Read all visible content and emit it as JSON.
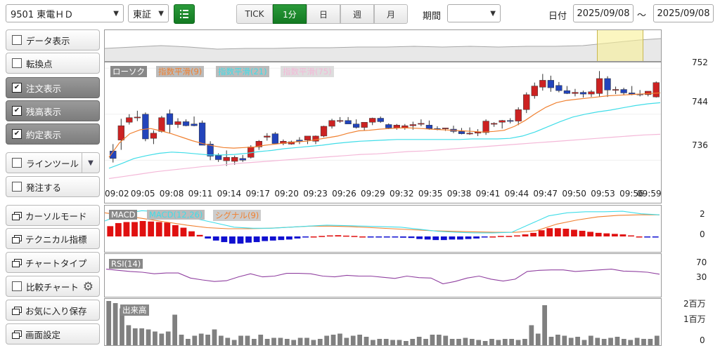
{
  "toolbar": {
    "symbol": "9501 東電ＨＤ",
    "exchange": "東証",
    "intervals": [
      "TICK",
      "1分",
      "日",
      "週",
      "月"
    ],
    "active_interval": "1分",
    "period_label": "期間",
    "period_value": "",
    "date_label": "日付",
    "date_from": "2025/09/08",
    "date_sep": "～",
    "date_to": "2025/09/08"
  },
  "sidebar": [
    {
      "label": "データ表示",
      "kind": "check",
      "checked": false
    },
    {
      "label": "転換点",
      "kind": "check",
      "checked": false
    },
    {
      "label": "注文表示",
      "kind": "check",
      "checked": true
    },
    {
      "label": "残高表示",
      "kind": "check",
      "checked": true
    },
    {
      "label": "約定表示",
      "kind": "check",
      "checked": true
    },
    {
      "label": "ラインツール",
      "kind": "check-dropdown",
      "checked": false
    },
    {
      "label": "発注する",
      "kind": "check",
      "checked": false
    },
    {
      "label": "カーソルモード",
      "kind": "window"
    },
    {
      "label": "テクニカル指標",
      "kind": "window"
    },
    {
      "label": "チャートタイプ",
      "kind": "window"
    },
    {
      "label": "比較チャート",
      "kind": "check-gear",
      "checked": false
    },
    {
      "label": "お気に入り保存",
      "kind": "window"
    },
    {
      "label": "画面設定",
      "kind": "window"
    }
  ],
  "colors": {
    "up": "#cc2222",
    "down": "#2244bb",
    "ema9": "#f08030",
    "ema21": "#40dde8",
    "ema75": "#f4b8d8",
    "rsi": "#9040a0",
    "volume": "#808080",
    "active_green": "#1a8a2a"
  },
  "chart_data": [
    {
      "type": "candlestick",
      "title": "",
      "legend": [
        "ローソク",
        "指数平滑(9)",
        "指数平滑(21)",
        "指数平滑(75)"
      ],
      "x_ticks": [
        "09:02",
        "09:05",
        "09:08",
        "09:11",
        "09:14",
        "09:17",
        "09:20",
        "09:23",
        "09:26",
        "09:29",
        "09:32",
        "09:35",
        "09:38",
        "09:41",
        "09:44",
        "09:47",
        "09:50",
        "09:53",
        "09:56",
        "09:59"
      ],
      "y_ticks": [
        752,
        744,
        736
      ],
      "ylim": [
        732.5,
        753
      ],
      "ohlc": [
        [
          737.6,
          738.8,
          735.6,
          736.3
        ],
        [
          739.5,
          743.2,
          737.8,
          742.0
        ],
        [
          742.6,
          744.0,
          742.2,
          743.4
        ],
        [
          743.4,
          744.6,
          742.8,
          743.5
        ],
        [
          744.0,
          744.3,
          739.3,
          739.7
        ],
        [
          739.8,
          741.2,
          738.8,
          740.7
        ],
        [
          741.0,
          743.7,
          740.8,
          743.4
        ],
        [
          744.1,
          744.8,
          740.7,
          742.2
        ],
        [
          742.2,
          743.3,
          741.6,
          742.7
        ],
        [
          742.7,
          743.1,
          741.9,
          742.0
        ],
        [
          742.3,
          743.6,
          741.9,
          742.0
        ],
        [
          742.5,
          742.9,
          738.6,
          738.6
        ],
        [
          738.8,
          739.3,
          736.0,
          736.7
        ],
        [
          736.8,
          737.2,
          735.7,
          736.1
        ],
        [
          735.9,
          737.7,
          735.0,
          736.5
        ],
        [
          735.8,
          736.8,
          735.2,
          736.5
        ],
        [
          736.3,
          736.9,
          735.7,
          736.0
        ],
        [
          736.5,
          738.6,
          736.3,
          738.3
        ],
        [
          738.3,
          739.5,
          737.8,
          739.3
        ],
        [
          740.0,
          740.7,
          739.4,
          740.2
        ],
        [
          740.6,
          740.9,
          738.9,
          738.9
        ],
        [
          738.9,
          739.6,
          738.6,
          739.3
        ],
        [
          738.8,
          739.4,
          738.7,
          739.2
        ],
        [
          739.5,
          740.0,
          738.8,
          739.3
        ],
        [
          739.5,
          740.0,
          738.8,
          740.2
        ],
        [
          739.3,
          740.3,
          738.8,
          740.2
        ],
        [
          740.2,
          742.0,
          740.0,
          741.9
        ],
        [
          741.9,
          743.2,
          741.5,
          742.9
        ],
        [
          742.9,
          743.5,
          742.5,
          742.9
        ],
        [
          742.9,
          743.5,
          742.5,
          742.3
        ],
        [
          742.3,
          743.1,
          741.5,
          741.7
        ],
        [
          741.7,
          742.6,
          741.1,
          742.6
        ],
        [
          742.6,
          743.4,
          742.1,
          743.3
        ],
        [
          743.3,
          743.6,
          742.5,
          742.7
        ],
        [
          742.2,
          742.4,
          741.4,
          741.6
        ],
        [
          741.6,
          742.3,
          741.3,
          742.1
        ],
        [
          741.6,
          742.3,
          741.3,
          742.0
        ],
        [
          742.0,
          742.7,
          741.3,
          742.2
        ],
        [
          742.3,
          743.1,
          741.9,
          742.4
        ],
        [
          742.1,
          742.9,
          741.3,
          741.5
        ],
        [
          741.5,
          741.9,
          741.2,
          741.4
        ],
        [
          741.5,
          741.6,
          741.1,
          741.6
        ],
        [
          741.4,
          742.0,
          740.7,
          741.0
        ],
        [
          741.0,
          741.6,
          740.5,
          740.6
        ],
        [
          740.6,
          741.7,
          740.4,
          740.7
        ],
        [
          740.7,
          741.4,
          740.2,
          740.9
        ],
        [
          740.8,
          743.1,
          740.4,
          742.8
        ],
        [
          742.3,
          742.6,
          741.8,
          742.4
        ],
        [
          742.6,
          743.0,
          741.5,
          742.9
        ],
        [
          742.9,
          743.3,
          742.4,
          742.8
        ],
        [
          742.8,
          745.2,
          742.1,
          744.8
        ],
        [
          744.8,
          747.8,
          744.2,
          747.4
        ],
        [
          747.2,
          749.5,
          746.7,
          748.9
        ],
        [
          748.7,
          751.0,
          748.1,
          749.9
        ],
        [
          749.9,
          750.7,
          747.9,
          748.6
        ],
        [
          749.0,
          749.6,
          747.8,
          748.1
        ],
        [
          748.1,
          748.9,
          747.5,
          747.6
        ],
        [
          747.6,
          748.4,
          747.1,
          747.8
        ],
        [
          747.8,
          748.1,
          746.9,
          747.5
        ],
        [
          747.5,
          748.2,
          747.0,
          747.9
        ],
        [
          747.6,
          751.5,
          747.0,
          750.2
        ],
        [
          750.2,
          750.6,
          747.0,
          748.2
        ],
        [
          748.2,
          748.8,
          747.5,
          748.3
        ],
        [
          748.3,
          748.6,
          747.3,
          747.7
        ],
        [
          747.7,
          748.9,
          747.3,
          747.5
        ],
        [
          747.5,
          748.2,
          747.1,
          747.4
        ],
        [
          747.4,
          748.0,
          747.1,
          748.0
        ],
        [
          747.0,
          749.7,
          746.9,
          749.5
        ]
      ],
      "ema9": [
        736.5,
        739.0,
        740.6,
        741.3,
        741.5,
        741.1,
        740.6,
        740.0,
        739.4,
        738.9,
        738.5,
        738.2,
        738.1,
        738.2,
        738.3,
        738.6,
        738.8,
        739.0,
        739.2,
        739.3,
        739.6,
        739.9,
        740.2,
        740.7,
        741.1,
        741.2,
        741.4,
        741.5,
        741.6,
        741.6,
        741.5,
        741.4,
        741.3,
        741.2,
        741.1,
        741.0,
        740.9,
        741.0,
        741.2,
        741.9,
        742.9,
        744.1,
        745.2,
        746.0,
        746.4,
        746.6,
        746.8,
        747.0,
        747.2,
        747.3,
        747.4,
        747.5,
        747.6,
        747.7
      ],
      "ema21": [
        734.6,
        735.4,
        736.3,
        736.8,
        737.2,
        737.4,
        737.3,
        737.1,
        736.9,
        736.9,
        737.0,
        737.2,
        737.5,
        737.7,
        738.0,
        738.2,
        738.4,
        738.6,
        738.9,
        739.1,
        739.3,
        739.4,
        739.5,
        739.6,
        739.6,
        739.6,
        739.6,
        739.6,
        739.6,
        739.7,
        739.7,
        739.7,
        739.8,
        740.2,
        740.9,
        741.8,
        742.7,
        743.5,
        744.0,
        744.4,
        744.7,
        745.1,
        745.5,
        745.8,
        746.0
      ],
      "ema75": [
        732.8,
        733.2,
        733.6,
        734.0,
        734.3,
        734.6,
        734.9,
        735.1,
        735.4,
        735.6,
        735.8,
        736.0,
        736.2,
        736.4,
        736.6,
        736.8,
        737.0,
        737.1,
        737.3,
        737.5,
        737.6,
        737.8,
        738.0,
        738.2,
        738.4,
        738.6,
        738.8,
        739.0,
        739.2,
        739.4,
        739.6,
        739.8,
        740.0,
        740.2,
        740.4,
        740.5
      ]
    },
    {
      "type": "bar",
      "title": "",
      "legend": [
        "MACD",
        "MACD(12,26)",
        "シグナル(9)"
      ],
      "y_ticks": [
        2,
        0
      ],
      "ylim": [
        -1.5,
        3
      ],
      "histogram": [
        1.0,
        1.3,
        1.4,
        1.4,
        1.5,
        1.45,
        1.4,
        1.35,
        1.1,
        0.85,
        0.5,
        0.15,
        -0.2,
        -0.4,
        -0.55,
        -0.7,
        -0.7,
        -0.6,
        -0.55,
        -0.45,
        -0.4,
        -0.35,
        -0.3,
        -0.2,
        -0.1,
        0.0,
        0.05,
        0.1,
        0.12,
        0.08,
        0.05,
        0.0,
        -0.02,
        -0.05,
        -0.08,
        -0.1,
        -0.12,
        -0.15,
        -0.25,
        -0.3,
        -0.35,
        -0.35,
        -0.3,
        -0.3,
        -0.25,
        -0.2,
        -0.1,
        0.0,
        0.05,
        0.05,
        0.1,
        0.2,
        0.35,
        0.6,
        0.8,
        0.8,
        0.75,
        0.65,
        0.55,
        0.45,
        0.35,
        0.3,
        0.25,
        0.2,
        0.1,
        0.0,
        -0.05,
        -0.1
      ],
      "macd": [
        1.5,
        2.2,
        2.5,
        2.4,
        2.1,
        1.7,
        1.3,
        0.9,
        0.8,
        0.8,
        0.9,
        1.0,
        1.1,
        1.05,
        1.0,
        0.95,
        0.9,
        0.7,
        0.5,
        0.4,
        0.35,
        0.35,
        0.4,
        1.2,
        2.0,
        2.3,
        2.4,
        2.4,
        2.45,
        2.2,
        2.1
      ],
      "signal": [
        2.3,
        2.0,
        1.7,
        1.4,
        1.1,
        0.85,
        0.75,
        0.75,
        0.8,
        0.9,
        1.0,
        1.0,
        0.95,
        0.85,
        0.75,
        0.65,
        0.55,
        0.5,
        0.45,
        0.4,
        0.4,
        0.55,
        1.2,
        1.6,
        1.9,
        2.05,
        2.1,
        2.1
      ]
    },
    {
      "type": "line",
      "title": "",
      "legend": [
        "RSI(14)"
      ],
      "y_ticks": [
        70,
        30
      ],
      "ylim": [
        0,
        100
      ],
      "values": [
        68,
        65,
        62,
        60,
        56,
        58,
        58,
        45,
        40,
        36,
        38,
        48,
        56,
        48,
        50,
        57,
        57,
        56,
        50,
        48,
        52,
        50,
        50,
        47,
        44,
        50,
        46,
        45,
        30,
        36,
        45,
        50,
        42,
        37,
        42,
        62,
        65,
        66,
        66,
        62,
        64,
        66,
        68,
        63,
        62,
        60,
        55
      ]
    },
    {
      "type": "bar",
      "title": "",
      "legend": [
        "出来高"
      ],
      "y_ticks": [
        "2百万",
        "1百万",
        "0"
      ],
      "ylim": [
        0,
        2.2
      ],
      "values": [
        2.1,
        2.0,
        1.75,
        0.95,
        0.8,
        0.8,
        0.75,
        0.65,
        0.55,
        0.65,
        1.45,
        0.5,
        0.3,
        0.45,
        0.55,
        0.5,
        0.75,
        0.45,
        0.35,
        0.25,
        0.45,
        0.45,
        0.3,
        0.5,
        0.3,
        0.35,
        0.35,
        0.3,
        0.25,
        0.35,
        0.35,
        0.25,
        0.3,
        0.45,
        0.5,
        0.55,
        0.35,
        0.45,
        0.5,
        0.4,
        0.25,
        0.3,
        0.3,
        0.25,
        0.25,
        0.2,
        0.3,
        0.4,
        0.3,
        0.5,
        0.5,
        0.45,
        0.3,
        0.3,
        0.35,
        0.3,
        0.25,
        0.2,
        0.3,
        0.25,
        0.3,
        0.3,
        0.25,
        0.3,
        0.95,
        0.55,
        1.9,
        0.4,
        0.5,
        0.45,
        0.35,
        0.4,
        0.25,
        0.45,
        0.35,
        0.3,
        0.35,
        0.4,
        0.3,
        0.25,
        0.35,
        0.3,
        0.3,
        0.45
      ]
    }
  ]
}
